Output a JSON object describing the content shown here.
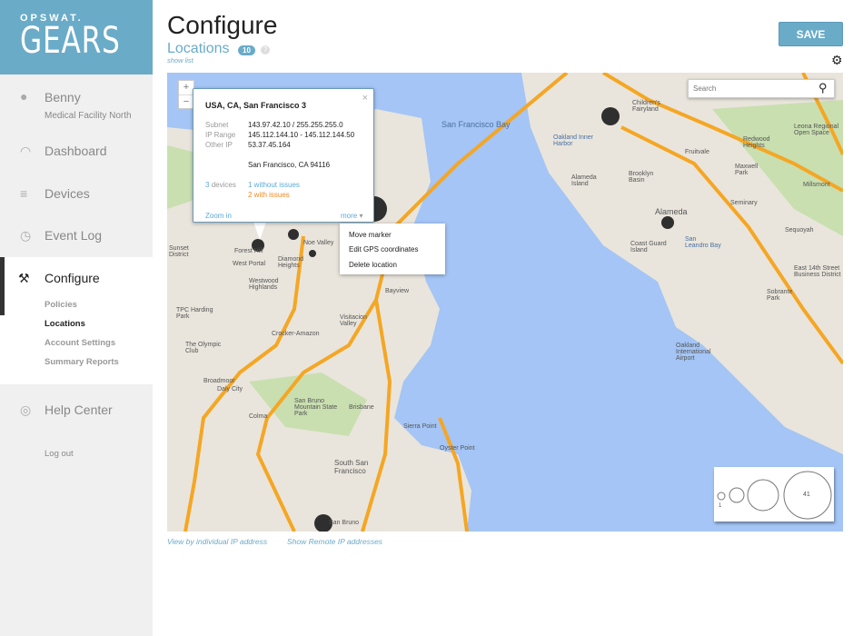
{
  "logo": {
    "top": "OPSWAT.",
    "big": "GEARS"
  },
  "user": {
    "name": "Benny",
    "org": "Medical Facility North",
    "icon": "user-icon"
  },
  "nav": [
    {
      "label": "Dashboard",
      "icon": "gauge-icon"
    },
    {
      "label": "Devices",
      "icon": "list-icon"
    },
    {
      "label": "Event Log",
      "icon": "clock-icon"
    },
    {
      "label": "Configure",
      "icon": "tools-icon"
    },
    {
      "label": "Help Center",
      "icon": "lifebuoy-icon"
    }
  ],
  "configure_sub": [
    "Policies",
    "Locations",
    "Account Settings",
    "Summary Reports"
  ],
  "logout": "Log out",
  "header": {
    "title": "Configure",
    "subtitle": "Locations",
    "count": "10",
    "help": "?",
    "show_list": "show list",
    "save": "SAVE"
  },
  "colors": {
    "accent": "#6aabc8",
    "issues": "#f08a24",
    "ok": "#5aaad8",
    "water": "#a4c5f5",
    "land": "#e9e5dc",
    "road": "#f5a623"
  },
  "map": {
    "zoom_in": "+",
    "zoom_out": "−",
    "search_placeholder": "Search",
    "labels": [
      "San Francisco Bay",
      "Alameda",
      "Oakland International Airport",
      "South San Francisco",
      "San Bruno",
      "Bayview",
      "Brisbane",
      "San Bruno Mountain State Park",
      "Daly City",
      "Colma",
      "Broadmoor",
      "The Olympic Club",
      "TPC Harding Park",
      "Westwood Highlands",
      "West Portal",
      "Diamond Heights",
      "Noe Valley",
      "Forest Hill",
      "Sunset District",
      "Visitacion Valley",
      "Crocker-Amazon",
      "Children's Fairyland",
      "Oakland Inner Harbor",
      "Alameda Island",
      "Fruitvale",
      "Brooklyn Basin",
      "Maxwell Park",
      "Redwood Heights",
      "Leona Regional Open Space",
      "Seminary",
      "San Leandro Bay",
      "East 14th Street Business District",
      "Sobrante Park",
      "Oyster Point",
      "Sierra Point",
      "Coast Guard Island",
      "Millsmont",
      "Sequoyah"
    ],
    "popup": {
      "title": "USA, CA, San Francisco 3",
      "subnet_label": "Subnet",
      "subnet": "143.97.42.10 / 255.255.255.0",
      "range_label": "IP Range",
      "range": "145.112.144.10 - 145.112.144.50",
      "other_label": "Other IP",
      "other": "53.37.45.164",
      "address": "San Francisco, CA 94116",
      "devices_count": "3",
      "devices_label": "devices",
      "without_issues": "1 without issues",
      "with_issues": "2 with issues",
      "zoom_in": "Zoom in",
      "more": "more"
    },
    "menu": [
      "Move marker",
      "Edit GPS coordinates",
      "Delete location"
    ],
    "legend": {
      "min": "1",
      "max": "41"
    }
  },
  "links": {
    "by_ip": "View by individual IP address",
    "remote": "Show Remote IP addresses"
  }
}
